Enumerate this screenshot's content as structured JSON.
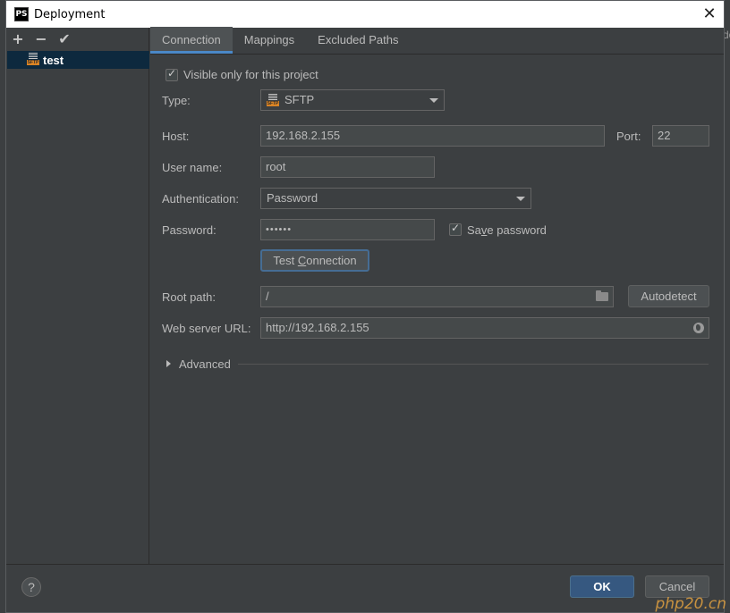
{
  "window": {
    "title": "Deployment",
    "app_icon_text": "PS",
    "close_glyph": "✕"
  },
  "background": {
    "right_edge_text": "do"
  },
  "sidebar": {
    "toolbar": {
      "add": "+",
      "remove": "−",
      "apply": "✔"
    },
    "items": [
      {
        "label": "test",
        "icon": "sftp-server-icon",
        "selected": true
      }
    ]
  },
  "tabs": [
    {
      "label": "Connection",
      "active": true
    },
    {
      "label": "Mappings",
      "active": false
    },
    {
      "label": "Excluded Paths",
      "active": false
    }
  ],
  "connection": {
    "visible_only": {
      "label": "Visible only for this project",
      "checked": true
    },
    "type": {
      "label": "Type:",
      "value": "SFTP"
    },
    "host": {
      "label": "Host:",
      "value": "192.168.2.155"
    },
    "port": {
      "label": "Port:",
      "value": "22"
    },
    "user_name": {
      "label": "User name:",
      "value": "root"
    },
    "authentication": {
      "label": "Authentication:",
      "value": "Password"
    },
    "password": {
      "label": "Password:",
      "value": "••••••"
    },
    "save_password": {
      "label_pre": "Sa",
      "label_u": "v",
      "label_post": "e password",
      "checked": true
    },
    "test_connection": {
      "label_pre": "Test ",
      "label_u": "C",
      "label_post": "onnection"
    },
    "root_path": {
      "label": "Root path:",
      "value": "/"
    },
    "autodetect": {
      "label": "Autodetect"
    },
    "web_server_url": {
      "label": "Web server URL:",
      "value": "http://192.168.2.155"
    },
    "advanced": {
      "label": "Advanced"
    }
  },
  "footer": {
    "help": "?",
    "ok": "OK",
    "cancel": "Cancel"
  },
  "watermark": "php20.cn",
  "colors": {
    "accent": "#4a88c7",
    "primary_button": "#365880",
    "selection": "#0d293e",
    "panel": "#3c3f41"
  }
}
